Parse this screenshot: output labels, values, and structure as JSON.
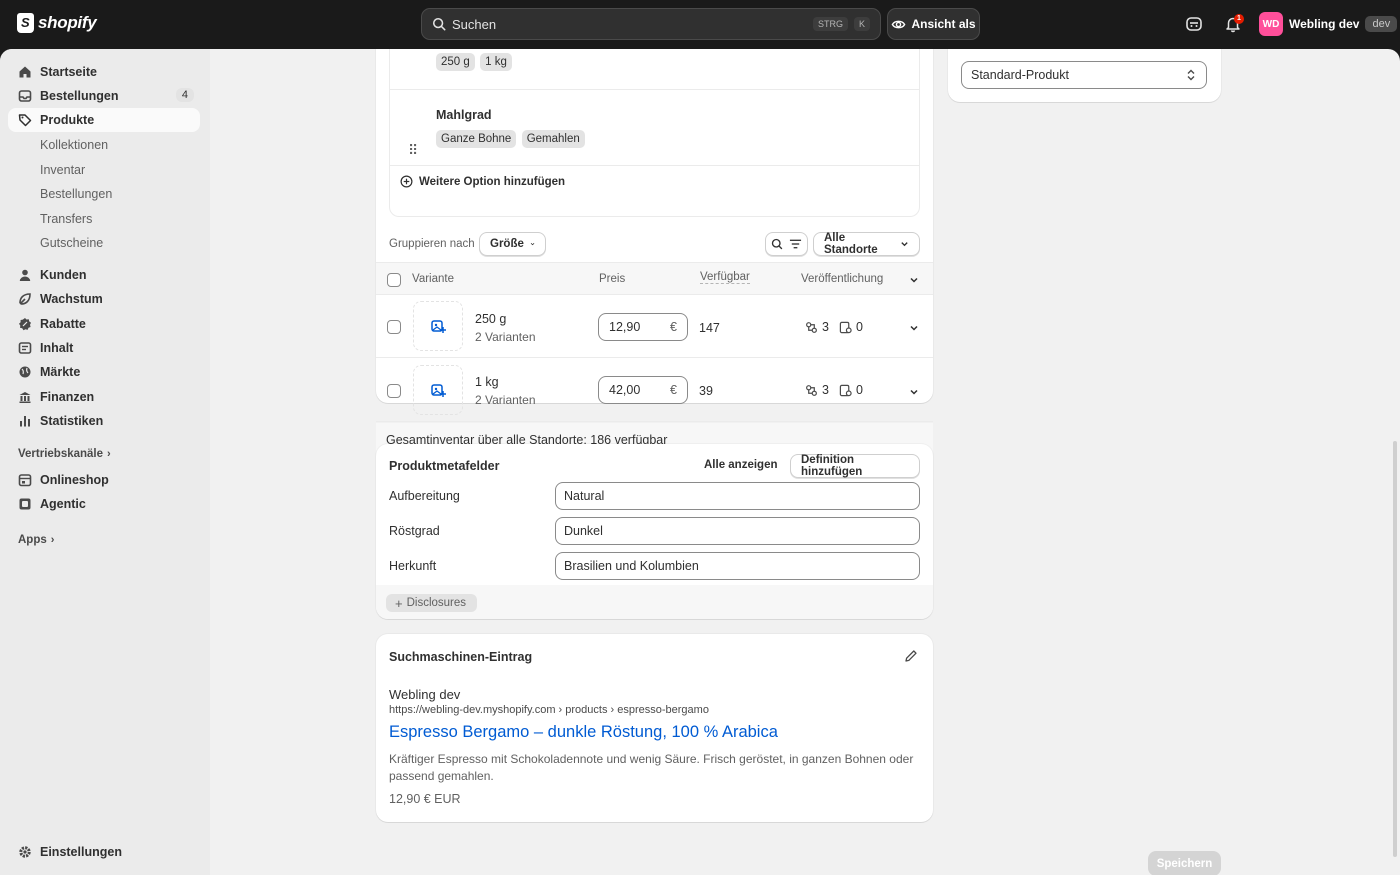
{
  "topbar": {
    "logo_text": "shopify",
    "search_placeholder": "Suchen",
    "shortcut_key1": "STRG",
    "shortcut_key2": "K",
    "view_as_label": "Ansicht als",
    "notification_count": "1",
    "avatar_initials": "WD",
    "store_name": "Webling dev",
    "store_badge": "dev"
  },
  "sidebar": {
    "items": [
      {
        "label": "Startseite",
        "icon": "home-icon"
      },
      {
        "label": "Bestellungen",
        "icon": "inbox-icon",
        "count": "4"
      },
      {
        "label": "Produkte",
        "icon": "tag-icon"
      }
    ],
    "sub_items": [
      "Kollektionen",
      "Inventar",
      "Bestellungen",
      "Transfers",
      "Gutscheine"
    ],
    "items2": [
      {
        "label": "Kunden",
        "icon": "person-icon"
      },
      {
        "label": "Wachstum",
        "icon": "growth-icon"
      },
      {
        "label": "Rabatte",
        "icon": "discount-icon"
      },
      {
        "label": "Inhalt",
        "icon": "content-icon"
      },
      {
        "label": "Märkte",
        "icon": "globe-icon"
      },
      {
        "label": "Finanzen",
        "icon": "bank-icon"
      },
      {
        "label": "Statistiken",
        "icon": "chart-icon"
      }
    ],
    "channels_head": "Vertriebskanäle",
    "channels": [
      {
        "label": "Onlineshop",
        "icon": "store-icon"
      },
      {
        "label": "Agentic",
        "icon": "agentic-icon"
      }
    ],
    "apps_head": "Apps",
    "settings_label": "Einstellungen"
  },
  "options": {
    "size_values": [
      "250 g",
      "1 kg"
    ],
    "grind_name": "Mahlgrad",
    "grind_values": [
      "Ganze Bohne",
      "Gemahlen"
    ],
    "add_option": "Weitere Option hinzufügen"
  },
  "variants": {
    "group_by_label": "Gruppieren nach",
    "group_by_value": "Größe",
    "locations": "Alle Standorte",
    "columns": {
      "variant": "Variante",
      "price": "Preis",
      "available": "Verfügbar",
      "publication": "Veröffentlichung"
    },
    "rows": [
      {
        "name": "250 g",
        "sub": "2 Varianten",
        "price": "12,90",
        "currency": "€",
        "available": "147",
        "channels": "3",
        "unpublished": "0"
      },
      {
        "name": "1 kg",
        "sub": "2 Varianten",
        "price": "42,00",
        "currency": "€",
        "available": "39",
        "channels": "3",
        "unpublished": "0"
      }
    ],
    "total": "Gesamtinventar über alle Standorte: 186 verfügbar"
  },
  "metafields": {
    "title": "Produktmetafelder",
    "show_all": "Alle anzeigen",
    "add_definition": "Definition hinzufügen",
    "fields": [
      {
        "label": "Aufbereitung",
        "value": "Natural"
      },
      {
        "label": "Röstgrad",
        "value": "Dunkel"
      },
      {
        "label": "Herkunft",
        "value": "Brasilien und Kolumbien"
      }
    ],
    "disclosures": "Disclosures"
  },
  "seo": {
    "title": "Suchmaschinen-Eintrag",
    "store": "Webling dev",
    "url": "https://webling-dev.myshopify.com › products › espresso-bergamo",
    "page_title": "Espresso Bergamo – dunkle Röstung, 100 % Arabica",
    "description": "Kräftiger Espresso mit Schokoladennote und wenig Säure. Frisch geröstet, in ganzen Bohnen oder passend gemahlen.",
    "price": "12,90 € EUR"
  },
  "right_panel": {
    "select_value": "Standard-Produkt"
  },
  "save_label": "Speichern",
  "colors": {
    "accent": "#005bd3",
    "topbar": "#1a1a1a",
    "avatar": "#ff4f9a",
    "badge": "#e51c00"
  }
}
